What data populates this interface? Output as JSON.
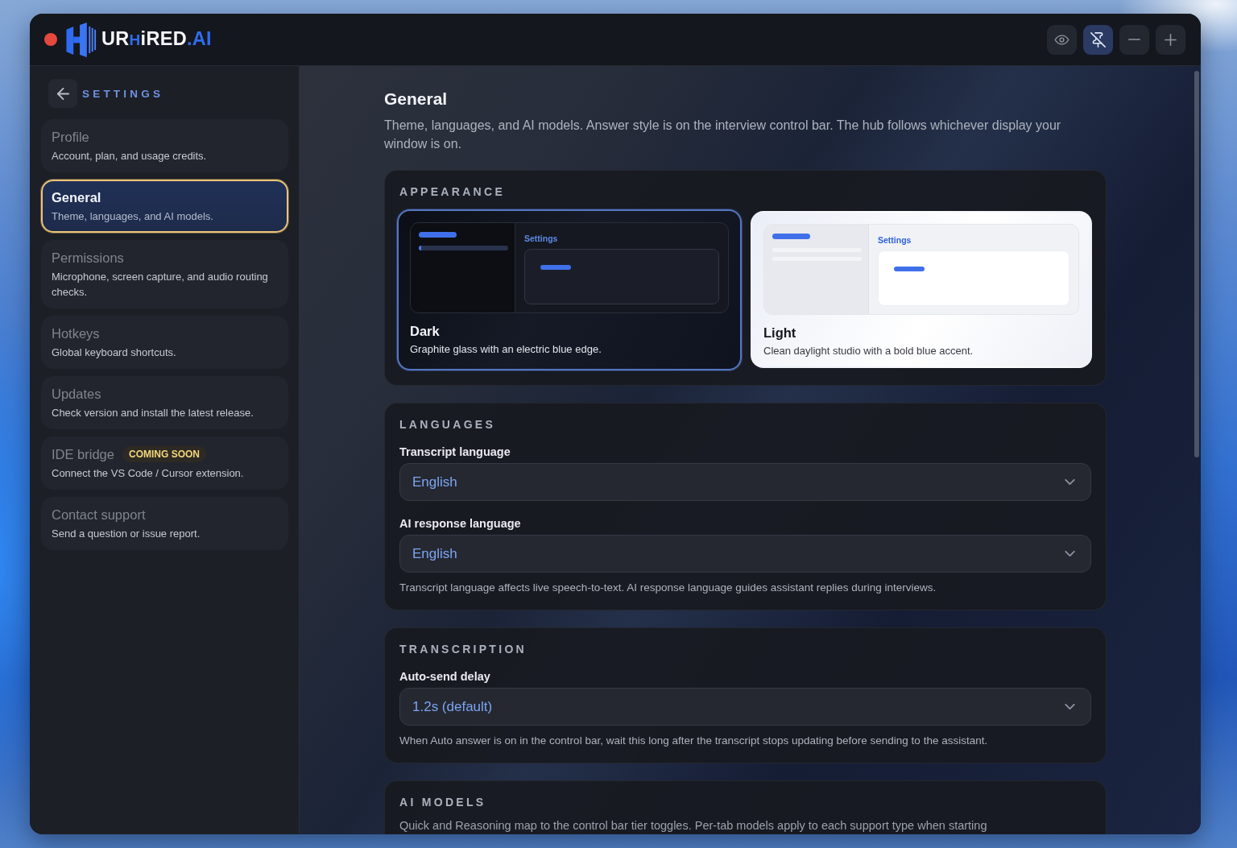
{
  "window": {
    "logo": {
      "parts": [
        {
          "text": "UR",
          "accent": false
        },
        {
          "text": "H",
          "accent": true
        },
        {
          "text": "iRED",
          "accent": false
        },
        {
          "text": ".AI",
          "accent": true
        }
      ]
    },
    "controls": [
      {
        "kind": "eye",
        "on": false
      },
      {
        "kind": "pin-off",
        "on": true
      },
      {
        "kind": "minus",
        "on": false
      },
      {
        "kind": "plus",
        "on": false
      }
    ]
  },
  "sidebar": {
    "title": "SETTINGS",
    "items": [
      {
        "title": "Profile",
        "description": "Account, plan, and usage credits.",
        "selected": false
      },
      {
        "title": "General",
        "description": "Theme, languages, and AI models.",
        "selected": true
      },
      {
        "title": "Permissions",
        "description": "Microphone, screen capture, and audio routing checks.",
        "selected": false
      },
      {
        "title": "Hotkeys",
        "description": "Global keyboard shortcuts.",
        "selected": false
      },
      {
        "title": "Updates",
        "description": "Check version and install the latest release.",
        "selected": false
      },
      {
        "title": "IDE bridge",
        "badge": "COMING SOON",
        "description": "Connect the VS Code / Cursor extension.",
        "selected": false
      },
      {
        "title": "Contact support",
        "description": "Send a question or issue report.",
        "selected": false
      }
    ]
  },
  "page": {
    "title": "General",
    "description": "Theme, languages, and AI models. Answer style is on the interview control bar. The hub follows whichever display your window is on.",
    "sections": [
      {
        "kind": "themes",
        "heading": "APPEARANCE",
        "themes": [
          {
            "kind": "dark",
            "name": "Dark",
            "description": "Graphite glass with an electric blue edge.",
            "preview_title": "Settings",
            "selected": true
          },
          {
            "kind": "light",
            "name": "Light",
            "description": "Clean daylight studio with a bold blue accent.",
            "preview_title": "Settings",
            "selected": false
          }
        ]
      },
      {
        "kind": "fields",
        "heading": "LANGUAGES",
        "fields": [
          {
            "label": "Transcript language",
            "value": "English"
          },
          {
            "label": "AI response language",
            "value": "English"
          }
        ],
        "hint": "Transcript language affects live speech-to-text. AI response language guides assistant replies during interviews."
      },
      {
        "kind": "fields",
        "heading": "TRANSCRIPTION",
        "fields": [
          {
            "label": "Auto-send delay",
            "value": "1.2s (default)"
          }
        ],
        "hint": "When Auto answer is on in the control bar, wait this long after the transcript stops updating before sending to the assistant."
      },
      {
        "kind": "text",
        "heading": "AI MODELS",
        "hint": "Quick and Reasoning map to the control bar tier toggles. Per-tab models apply to each support type when starting"
      }
    ]
  }
}
